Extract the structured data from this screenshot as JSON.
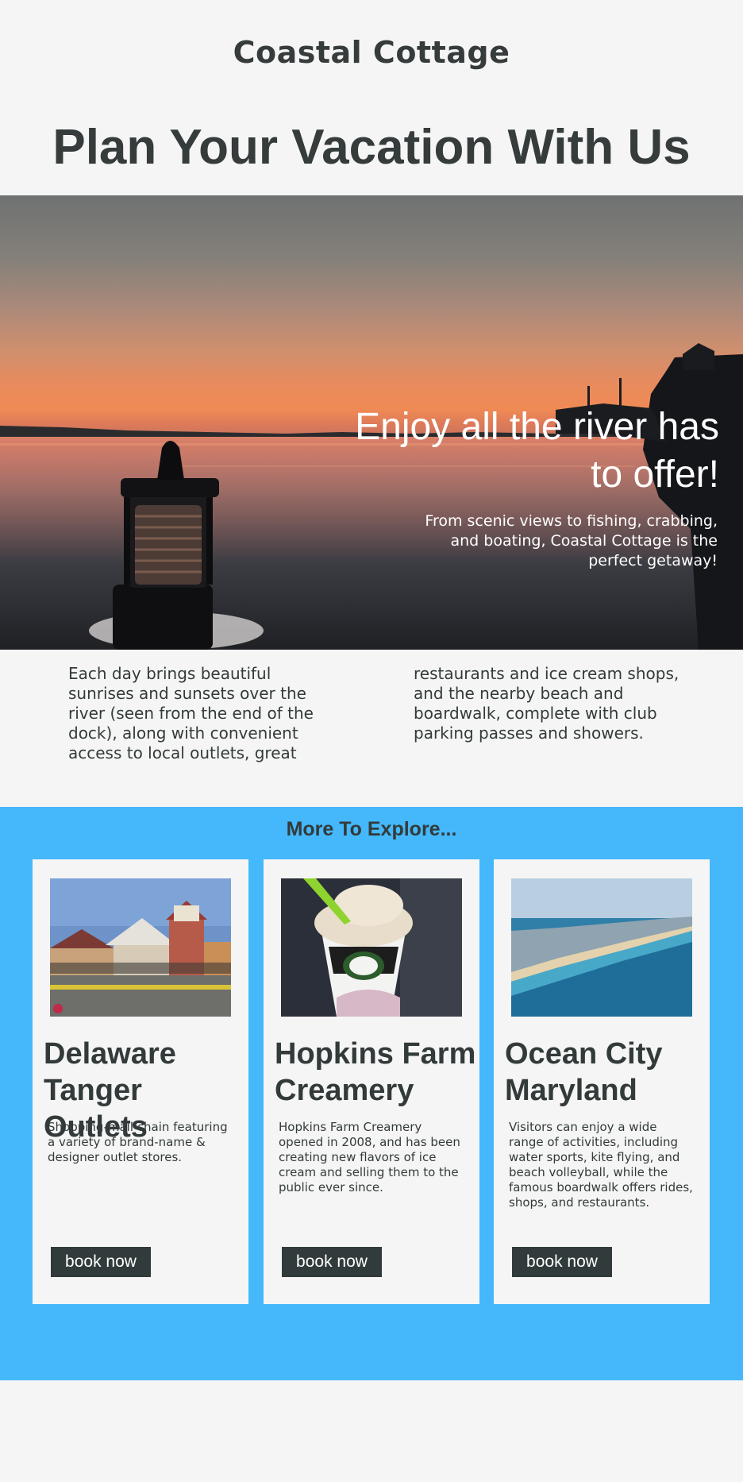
{
  "header": {
    "brand": "Coastal Cottage",
    "headline": "Plan Your Vacation With Us"
  },
  "hero": {
    "title": "Enjoy all the river has to offer!",
    "subtitle": "From scenic views to fishing, crabbing, and boating, Coastal Cottage is the perfect getaway!"
  },
  "intro": {
    "text": "Each day brings beautiful sunrises and sunsets over the river (seen from the end of the dock), along with convenient access to local outlets, great restaurants and ice cream shops, and the nearby beach and boardwalk, complete with club parking passes and showers."
  },
  "explore": {
    "title": "More To Explore...",
    "accent_color": "#44b8fb",
    "cards": [
      {
        "title": "Delaware Tanger Outlets",
        "description": "Shopping-mall chain featuring a variety of brand-name & designer outlet stores.",
        "button": "book now"
      },
      {
        "title": "Hopkins Farm Creamery",
        "description": "Hopkins Farm Creamery opened in 2008, and has been creating new flavors of ice cream and selling them to the public ever since.",
        "button": "book now"
      },
      {
        "title": "Ocean City Maryland",
        "description": "Visitors can enjoy a wide range of activities, including water sports, kite flying, and beach volleyball, while the famous boardwalk offers rides, shops, and restaurants.",
        "button": "book now"
      }
    ]
  }
}
